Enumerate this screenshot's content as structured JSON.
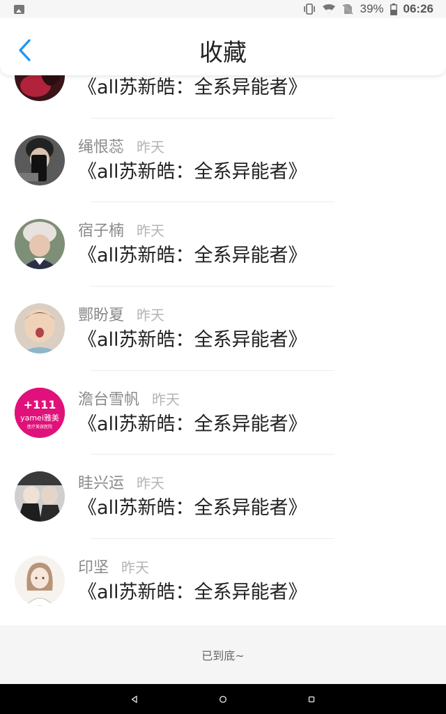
{
  "status_bar": {
    "battery": "39%",
    "time": "06:26",
    "icons": [
      "image-icon",
      "vibrate-icon",
      "wifi-icon",
      "no-sim-icon",
      "battery-icon"
    ]
  },
  "header": {
    "title": "收藏",
    "back_icon": "chevron-left-icon",
    "accent": "#2196f3"
  },
  "items": [
    {
      "username": "",
      "date": "",
      "title": "《all苏新皓：全系异能者》",
      "avatar_color": "#b0233a"
    },
    {
      "username": "绳恨蕊",
      "date": "昨天",
      "title": "《all苏新皓：全系异能者》",
      "avatar_color": "#4a4a4a"
    },
    {
      "username": "宿子楠",
      "date": "昨天",
      "title": "《all苏新皓：全系异能者》",
      "avatar_color": "#6b5b5e"
    },
    {
      "username": "酆盼夏",
      "date": "昨天",
      "title": "《all苏新皓：全系异能者》",
      "avatar_color": "#c9a889"
    },
    {
      "username": "澹台雪帆",
      "date": "昨天",
      "title": "《all苏新皓：全系异能者》",
      "avatar_color": "#e0117a",
      "avatar_text": [
        "+111",
        "yamei雅美",
        "医疗美容医院"
      ]
    },
    {
      "username": "眭兴运",
      "date": "昨天",
      "title": "《all苏新皓：全系异能者》",
      "avatar_color": "#2e2e2e"
    },
    {
      "username": "印坚",
      "date": "昨天",
      "title": "《all苏新皓：全系异能者》",
      "avatar_color": "#efe7e0"
    }
  ],
  "footer": {
    "end_text": "已到底~"
  },
  "nav": {
    "back": "nav-back-icon",
    "home": "nav-home-icon",
    "recents": "nav-recents-icon"
  }
}
